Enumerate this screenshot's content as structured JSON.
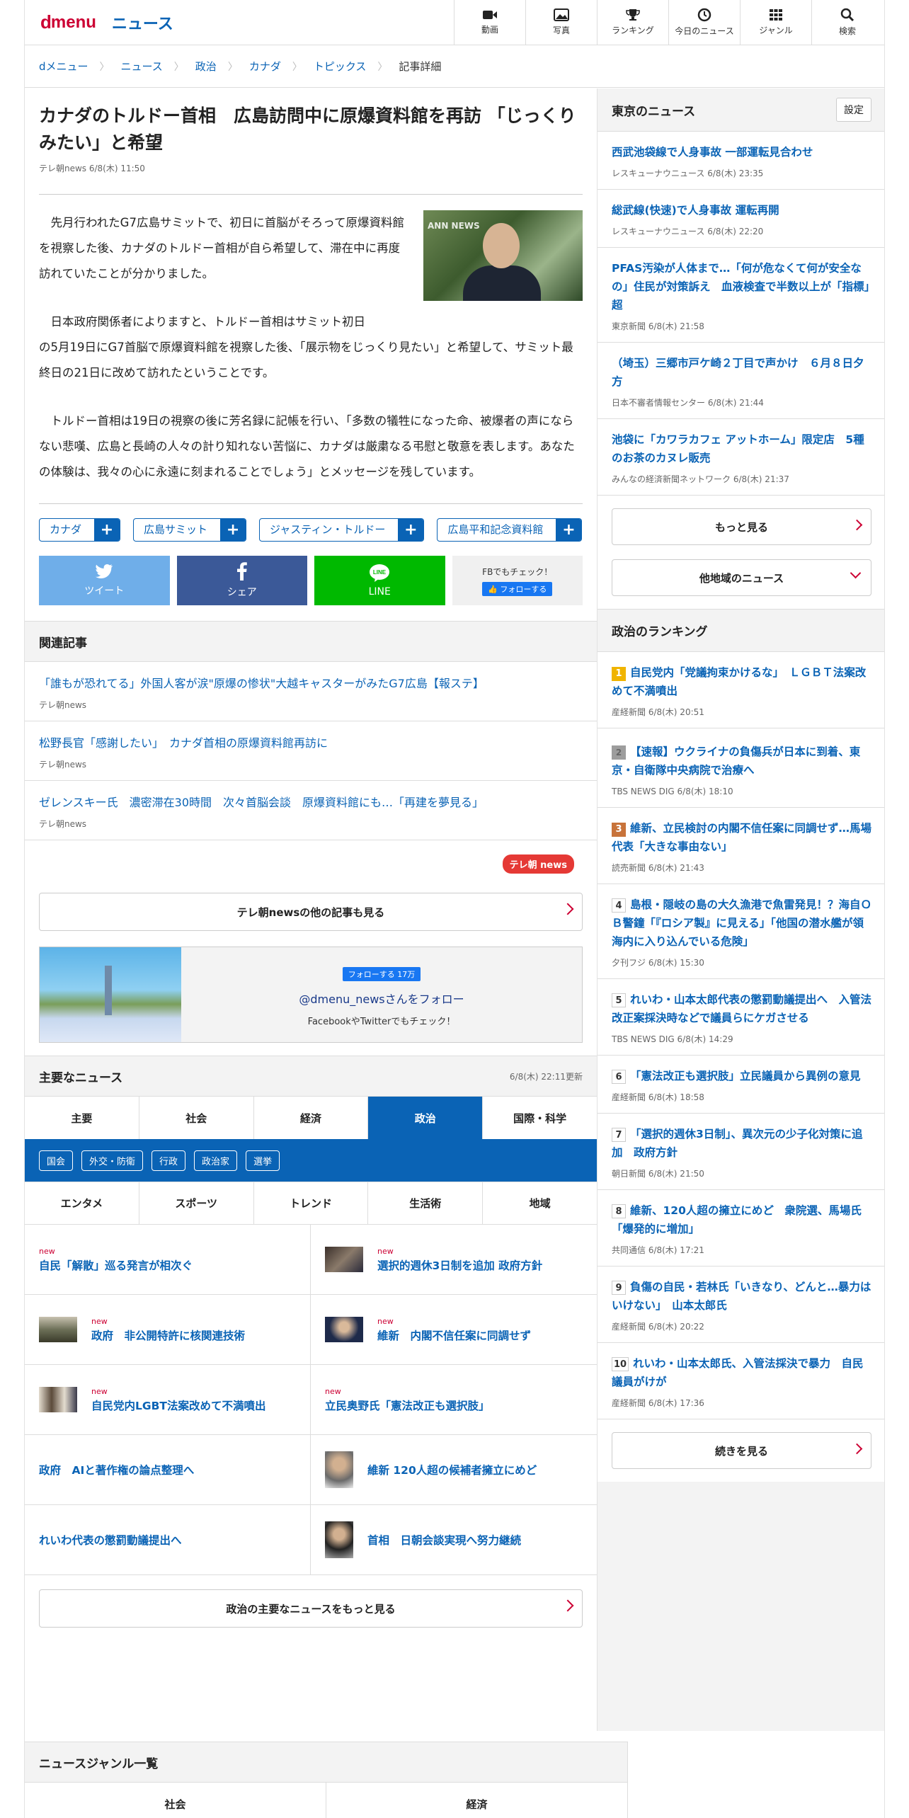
{
  "header": {
    "logo_d": "d",
    "logo_menu": "menu",
    "logo_news": "ニュース",
    "nav": [
      {
        "label": "動画",
        "icon": "video-icon"
      },
      {
        "label": "写真",
        "icon": "photo-icon"
      },
      {
        "label": "ランキング",
        "icon": "trophy-icon"
      },
      {
        "label": "今日のニュース",
        "icon": "clock-icon"
      },
      {
        "label": "ジャンル",
        "icon": "grid-icon"
      },
      {
        "label": "検索",
        "icon": "search-icon"
      }
    ]
  },
  "breadcrumb": [
    "dメニュー",
    "ニュース",
    "政治",
    "カナダ",
    "トピックス",
    "記事詳細"
  ],
  "article": {
    "title": "カナダのトルドー首相　広島訪問中に原爆資料館を再訪 「じっくりみたい」と希望",
    "meta": "テレ朝news 6/8(木) 11:50",
    "photo_label": "ANN NEWS",
    "p1": "　先月行われたG7広島サミットで、初日に首脳がそろって原爆資料館を視察した後、カナダのトルドー首相が自ら希望して、滞在中に再度訪れていたことが分かりました。",
    "p2a": "　日本政府関係者によりますと、トルドー首相はサミット初日",
    "p2b": "の5月19日にG7首脳で原爆資料館を視察した後、「展示物をじっくり見たい」と希望して、サミット最終日の21日に改めて訪れたということです。",
    "p3": "　トルドー首相は19日の視察の後に芳名録に記帳を行い、「多数の犠牲になった命、被爆者の声にならない悲嘆、広島と長崎の人々の計り知れない苦悩に、カナダは厳粛なる弔慰と敬意を表します。あなたの体験は、我々の心に永遠に刻まれることでしょう」とメッセージを残しています。",
    "tags": [
      "カナダ",
      "広島サミット",
      "ジャスティン・トルドー",
      "広島平和記念資料館"
    ],
    "share": {
      "tweet": "ツイート",
      "share": "シェア",
      "line": "LINE",
      "fb_check": "FBでもチェック！",
      "fb_follow": "フォローする"
    }
  },
  "related": {
    "heading": "関連記事",
    "items": [
      {
        "title": "「誰もが恐れてる」外国人客が涙\"原爆の惨状\"大越キャスターがみたG7広島【報ステ】",
        "source": "テレ朝news"
      },
      {
        "title": "松野長官「感謝したい」　カナダ首相の原爆資料館再訪に",
        "source": "テレ朝news"
      },
      {
        "title": "ゼレンスキー氏　濃密滞在30時間　次々首脳会談　原爆資料館にも…「再建を夢見る」",
        "source": "テレ朝news"
      }
    ]
  },
  "provider": {
    "logo": "テレ朝 news",
    "more": "テレ朝newsの他の記事も見る",
    "fb_follow": "フォローする 17万",
    "account": "@dmenu_newsさんをフォロー",
    "check": "FacebookやTwitterでもチェック！"
  },
  "major": {
    "heading": "主要なニュース",
    "updated": "6/8(木) 22:11更新",
    "tabs1": [
      "主要",
      "社会",
      "経済",
      "政治",
      "国際・科学"
    ],
    "chips": [
      "国会",
      "外交・防衛",
      "行政",
      "政治家",
      "選挙"
    ],
    "tabs2": [
      "エンタメ",
      "スポーツ",
      "トレンド",
      "生活術",
      "地域"
    ],
    "items": [
      {
        "title": "自民「解散」巡る発言が相次ぐ",
        "new": "new",
        "thumb": false
      },
      {
        "title": "選択的週休3日制を追加 政府方針",
        "new": "new",
        "thumb": true
      },
      {
        "title": "政府　非公開特許に核関連技術",
        "new": "new",
        "thumb": true
      },
      {
        "title": "維新　内閣不信任案に同調せず",
        "new": "new",
        "thumb": true
      },
      {
        "title": "自民党内LGBT法案改めて不満噴出",
        "new": "new",
        "thumb": true
      },
      {
        "title": "立民奥野氏「憲法改正も選択肢」",
        "new": "new",
        "thumb": false
      },
      {
        "title": "政府　AIと著作権の論点整理へ",
        "new": "",
        "thumb": false
      },
      {
        "title": "維新 120人超の候補者擁立にめど",
        "new": "",
        "thumb": true
      },
      {
        "title": "れいわ代表の懲罰動議提出へ",
        "new": "",
        "thumb": false
      },
      {
        "title": "首相　日朝会談実現へ努力継続",
        "new": "",
        "thumb": true
      }
    ],
    "more": "政治の主要なニュースをもっと見る"
  },
  "genre": {
    "heading": "ニュースジャンル一覧",
    "items": [
      "社会",
      "経済"
    ]
  },
  "side": {
    "local_heading": "東京のニュース",
    "settings": "設定",
    "local": [
      {
        "title": "西武池袋線で人身事故 一部運転見合わせ",
        "meta": "レスキューナウニュース 6/8(木) 23:35"
      },
      {
        "title": "総武線(快速)で人身事故 運転再開",
        "meta": "レスキューナウニュース 6/8(木) 22:20"
      },
      {
        "title": "PFAS汚染が人体まで…「何が危なくて何が安全なの」住民が対策訴え　血液検査で半数以上が「指標」超",
        "meta": "東京新聞 6/8(木) 21:58"
      },
      {
        "title": "（埼玉）三郷市戸ケ崎２丁目で声かけ　６月８日夕方",
        "meta": "日本不審者情報センター 6/8(木) 21:44"
      },
      {
        "title": "池袋に「カワラカフェ アットホーム」限定店　5種のお茶のカヌレ販売",
        "meta": "みんなの経済新聞ネットワーク 6/8(木) 21:37"
      }
    ],
    "more": "もっと見る",
    "other": "他地域のニュース",
    "rank_heading": "政治のランキング",
    "ranking": [
      {
        "n": "1",
        "title": "自民党内「党議拘束かけるな」　ＬＧＢＴ法案改めて不満噴出",
        "meta": "産経新聞 6/8(木) 20:51"
      },
      {
        "n": "2",
        "title": "【速報】ウクライナの負傷兵が日本に到着、東京・自衛隊中央病院で治療へ",
        "meta": "TBS NEWS DIG 6/8(木) 18:10"
      },
      {
        "n": "3",
        "title": "維新、立民検討の内閣不信任案に同調せず…馬場代表「大きな事由ない」",
        "meta": "読売新聞 6/8(木) 21:43"
      },
      {
        "n": "4",
        "title": "島根・隠岐の島の大久漁港で魚雷発見！？海自ＯＢ警鐘「『ロシア製』に見える」「他国の潜水艦が領海内に入り込んでいる危険」",
        "meta": "夕刊フジ 6/8(木) 15:30"
      },
      {
        "n": "5",
        "title": "れいわ・山本太郎代表の懲罰動議提出へ　入管法改正案採決時などで議員らにケガさせる",
        "meta": "TBS NEWS DIG 6/8(木) 14:29"
      },
      {
        "n": "6",
        "title": "「憲法改正も選択肢」立民議員から異例の意見",
        "meta": "産経新聞 6/8(木) 18:58"
      },
      {
        "n": "7",
        "title": "「選択的週休3日制」、異次元の少子化対策に追加　政府方針",
        "meta": "朝日新聞 6/8(木) 21:50"
      },
      {
        "n": "8",
        "title": "維新、120人超の擁立にめど　衆院選、馬場氏「爆発的に増加」",
        "meta": "共同通信 6/8(木) 17:21"
      },
      {
        "n": "9",
        "title": "負傷の自民・若林氏「いきなり、どんと…暴力はいけない」　山本太郎氏",
        "meta": "産経新聞 6/8(木) 20:22"
      },
      {
        "n": "10",
        "title": "れいわ・山本太郎氏、入管法採決で暴力　自民議員がけが",
        "meta": "産経新聞 6/8(木) 17:36"
      }
    ],
    "rank_more": "続きを見る"
  }
}
